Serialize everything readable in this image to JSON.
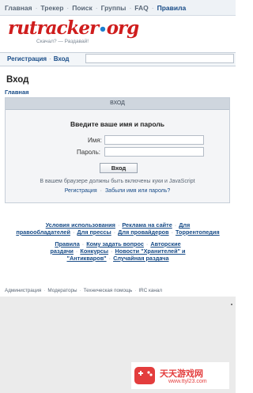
{
  "topnav": {
    "items": [
      "Главная",
      "Трекер",
      "Поиск",
      "Группы",
      "FAQ",
      "Правила"
    ]
  },
  "logo": {
    "ru": "ru",
    "tracker": "tracker",
    "dot": "•",
    "org": "org",
    "tagline": "Скачал? — Раздавай!"
  },
  "authnav": {
    "register": "Регистрация",
    "login": "Вход"
  },
  "page": {
    "title": "Вход",
    "breadcrumb": "Главная"
  },
  "login_panel": {
    "header": "ВХОД",
    "prompt": "Введите ваше имя и пароль",
    "username_label": "Имя:",
    "password_label": "Пароль:",
    "submit_label": "Вход",
    "cookie_note": "В вашем браузере должны быть включены куки и JavaScript",
    "register_link": "Регистрация",
    "forgot_link": "Забыли имя или пароль?"
  },
  "footer_links": {
    "row1": [
      "Условия использования",
      "Реклама на сайте",
      "Для правообладателей",
      "Для прессы",
      "Для провайдеров",
      "Торрентопедия"
    ],
    "row2": [
      "Правила",
      "Кому задать вопрос",
      "Авторские раздачи",
      "Конкурсы",
      "Новости \"Хранителей\" и \"Антикваров\"",
      "Случайная раздача"
    ]
  },
  "bottom_links": [
    "Администрация",
    "Модераторы",
    "Техническая помощь",
    "IRC канал"
  ],
  "watermark": {
    "title": "天天游戏网",
    "url": "www.ttyl23.com"
  },
  "colors": {
    "link": "#174b87",
    "logo_red": "#cf1d1d",
    "logo_blue": "#1c7fd0",
    "panel_bg": "#f4f5f7",
    "panel_header": "#cfd6de",
    "watermark_red": "#e33d3d"
  }
}
